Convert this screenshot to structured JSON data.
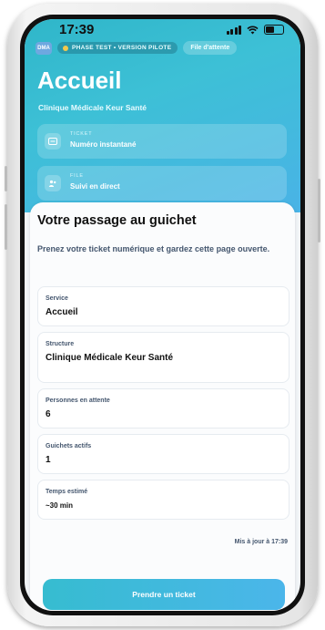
{
  "status_bar": {
    "time": "17:39"
  },
  "header": {
    "logo_text": "DMA",
    "phase_badge": "PHASE TEST • VERSION PILOTE",
    "queue_link": "File d'attente",
    "title": "Accueil",
    "subtitle": "Clinique Médicale Keur Santé",
    "cards": [
      {
        "label": "TICKET",
        "value": "Numéro instantané",
        "icon": "ticket-icon"
      },
      {
        "label": "FILE",
        "value": "Suivi en direct",
        "icon": "people-icon"
      }
    ]
  },
  "main": {
    "heading": "Votre passage au guichet",
    "intro": "Prenez votre ticket numérique et gardez cette page ouverte.",
    "fields": [
      {
        "key": "Service",
        "value": "Accueil"
      },
      {
        "key": "Structure",
        "value": "Clinique Médicale Keur Santé"
      },
      {
        "key": "Personnes en attente",
        "value": "6"
      },
      {
        "key": "Guichets actifs",
        "value": "1"
      },
      {
        "key": "Temps estimé",
        "value": "~30 min"
      }
    ],
    "updated": "Mis à jour à 17:39",
    "cta_label": "Prendre un ticket"
  },
  "colors": {
    "accent": "#3dbfd4",
    "accent_2": "#4bb6ea",
    "badge_dot": "#f2c94c"
  }
}
